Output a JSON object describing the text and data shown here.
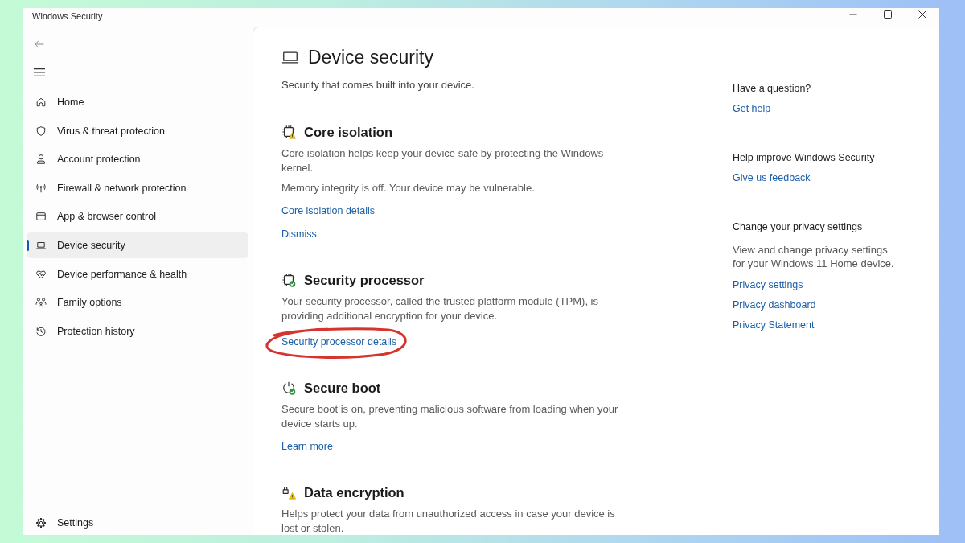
{
  "window": {
    "title": "Windows Security"
  },
  "sidebar": {
    "items": [
      {
        "label": "Home",
        "selected": false
      },
      {
        "label": "Virus & threat protection",
        "selected": false
      },
      {
        "label": "Account protection",
        "selected": false
      },
      {
        "label": "Firewall & network protection",
        "selected": false
      },
      {
        "label": "App & browser control",
        "selected": false
      },
      {
        "label": "Device security",
        "selected": true
      },
      {
        "label": "Device performance & health",
        "selected": false
      },
      {
        "label": "Family options",
        "selected": false
      },
      {
        "label": "Protection history",
        "selected": false
      }
    ],
    "footer": {
      "label": "Settings"
    }
  },
  "page": {
    "title": "Device security",
    "subtitle": "Security that comes built into your device."
  },
  "sections": [
    {
      "title": "Core isolation",
      "warning": true,
      "paragraphs": [
        "Core isolation helps keep your device safe by protecting the Windows kernel.",
        "Memory integrity is off. Your device may be vulnerable."
      ],
      "links": [
        {
          "label": "Core isolation details",
          "circled": false
        },
        {
          "label": "Dismiss",
          "circled": false
        }
      ]
    },
    {
      "title": "Security processor",
      "warning": false,
      "paragraphs": [
        "Your security processor, called the trusted platform module (TPM), is providing additional encryption for your device."
      ],
      "links": [
        {
          "label": "Security processor details",
          "circled": true
        }
      ]
    },
    {
      "title": "Secure boot",
      "warning": false,
      "paragraphs": [
        "Secure boot is on, preventing malicious software from loading when your device starts up."
      ],
      "links": [
        {
          "label": "Learn more",
          "circled": false
        }
      ]
    },
    {
      "title": "Data encryption",
      "warning": true,
      "paragraphs": [
        "Helps protect your data from unauthorized access in case your device is lost or stolen."
      ]
    }
  ],
  "aside": [
    {
      "heading": "Have a question?",
      "links": [
        "Get help"
      ]
    },
    {
      "heading": "Help improve Windows Security",
      "links": [
        "Give us feedback"
      ]
    },
    {
      "heading": "Change your privacy settings",
      "description": "View and change privacy settings for your Windows 11 Home device.",
      "links": [
        "Privacy settings",
        "Privacy dashboard",
        "Privacy Statement"
      ]
    }
  ]
}
